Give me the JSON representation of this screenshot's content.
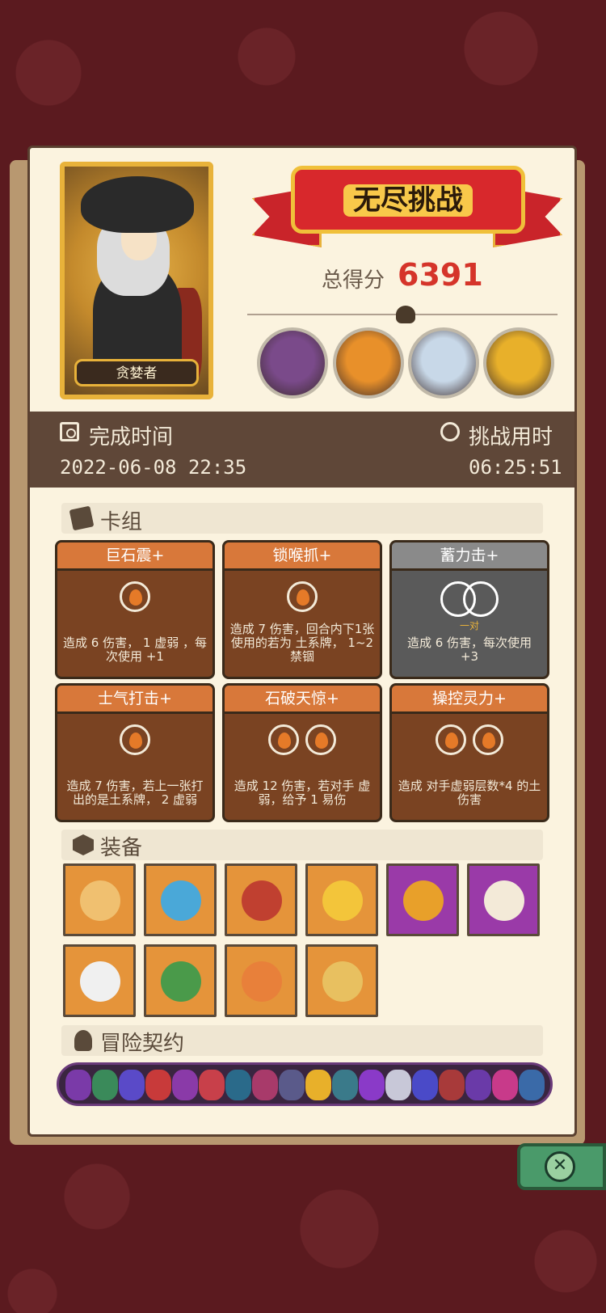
{
  "header": {
    "mode_title": "无尽挑战",
    "score_label": "总得分",
    "score_value": "6391",
    "character_name": "贪婪者"
  },
  "bosses": [
    {
      "name": "boss-stone-golem",
      "color": "#7a4a8a"
    },
    {
      "name": "boss-lion-king",
      "color": "#e8902a"
    },
    {
      "name": "boss-white-beast",
      "color": "#c8d8e8"
    },
    {
      "name": "boss-sun-pumpkin",
      "color": "#e8b02a"
    }
  ],
  "stats": {
    "complete_time_label": "完成时间",
    "complete_time_value": "2022-06-08 22:35",
    "challenge_time_label": "挑战用时",
    "challenge_time_value": "06:25:51"
  },
  "deck": {
    "title": "卡组",
    "cards": [
      {
        "name": "巨石震+",
        "desc": "造成 6 伤害， 1 虚弱 ，每次使用 +1",
        "orbs": 1,
        "style": "orange"
      },
      {
        "name": "锁喉抓+",
        "desc": "造成 7 伤害，回合内下1张使用的若为 土系牌， 1~2 禁锢",
        "orbs": 1,
        "style": "orange"
      },
      {
        "name": "蓄力击+",
        "desc": "造成 6 伤害，每次使用 +3",
        "orbs": 2,
        "orb_note": "一对",
        "style": "gray"
      },
      {
        "name": "士气打击+",
        "desc": "造成 7 伤害，若上一张打出的是土系牌， 2 虚弱",
        "orbs": 1,
        "style": "orange"
      },
      {
        "name": "石破天惊+",
        "desc": "造成 12 伤害，若对手 虚弱，给予 1 易伤",
        "orbs": 2,
        "style": "orange"
      },
      {
        "name": "操控灵力+",
        "desc": "造成 对手虚弱层数*4 的土伤害",
        "orbs": 2,
        "style": "orange"
      }
    ]
  },
  "equipment": {
    "title": "装备",
    "items": [
      {
        "name": "coin-bag",
        "bg": "orange",
        "color": "#f0c070"
      },
      {
        "name": "blue-shield",
        "bg": "orange",
        "color": "#4aa8d8"
      },
      {
        "name": "meat-leg",
        "bg": "orange",
        "color": "#c04030"
      },
      {
        "name": "golden-crown",
        "bg": "orange",
        "color": "#f3c53a"
      },
      {
        "name": "jeweled-bowl",
        "bg": "purple",
        "color": "#e8a02a"
      },
      {
        "name": "white-claws",
        "bg": "purple",
        "color": "#f3ead8"
      },
      {
        "name": "white-dice",
        "bg": "orange",
        "color": "#f0f0f0"
      },
      {
        "name": "green-stone",
        "bg": "orange",
        "color": "#4a9a4a"
      },
      {
        "name": "orange-cube",
        "bg": "orange",
        "color": "#e8803a"
      },
      {
        "name": "gold-ring",
        "bg": "orange",
        "color": "#e8c060"
      }
    ]
  },
  "contracts": {
    "title": "冒险契约",
    "count": 18
  }
}
